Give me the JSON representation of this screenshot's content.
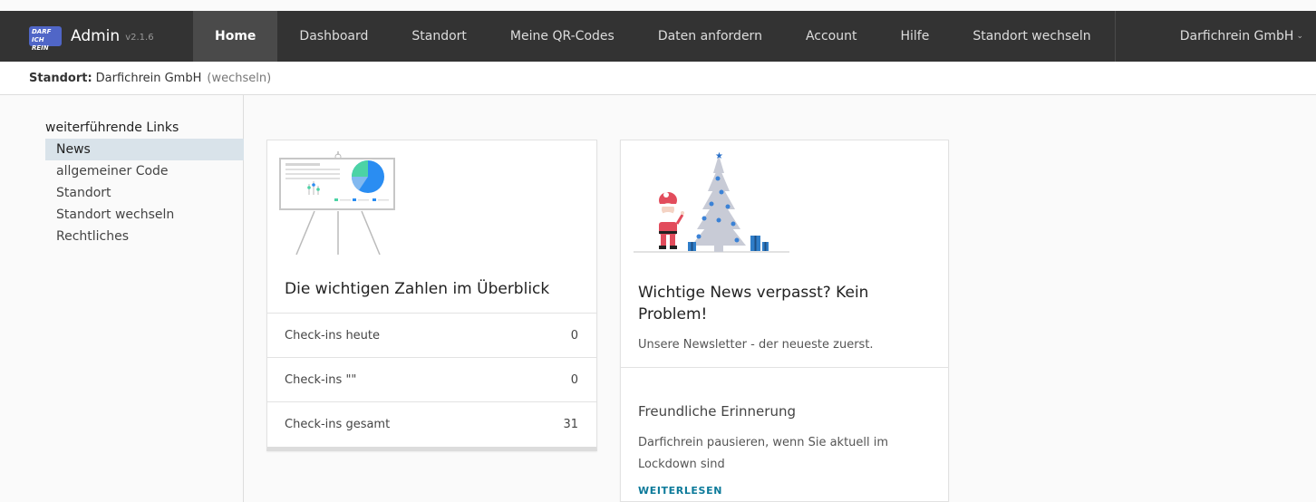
{
  "app": {
    "logo_text": "DARF ICH REIN",
    "name": "Admin",
    "version": "v2.1.6"
  },
  "nav": {
    "items": [
      {
        "label": "Home",
        "active": true
      },
      {
        "label": "Dashboard"
      },
      {
        "label": "Standort"
      },
      {
        "label": "Meine QR-Codes"
      },
      {
        "label": "Daten anfordern"
      },
      {
        "label": "Account"
      },
      {
        "label": "Hilfe"
      },
      {
        "label": "Standort wechseln"
      }
    ],
    "account_label": "Darfichrein GmbH"
  },
  "location_bar": {
    "label": "Standort:",
    "value": "Darfichrein GmbH",
    "change_link": "(wechseln)"
  },
  "sidebar": {
    "title": "weiterführende Links",
    "items": [
      {
        "label": "News",
        "active": true
      },
      {
        "label": "allgemeiner Code"
      },
      {
        "label": "Standort"
      },
      {
        "label": "Standort wechseln"
      },
      {
        "label": "Rechtliches"
      }
    ]
  },
  "stats_card": {
    "title": "Die wichtigen Zahlen im Überblick",
    "rows": [
      {
        "label": "Check-ins heute",
        "value": "0"
      },
      {
        "label": "Check-ins \"\"",
        "value": "0"
      },
      {
        "label": "Check-ins gesamt",
        "value": "31"
      }
    ]
  },
  "news_card": {
    "title": "Wichtige News verpasst? Kein Problem!",
    "subtitle": "Unsere Newsletter - der neueste zuerst.",
    "news_title": "Freundliche Erinnerung",
    "news_text": "Darfichrein pausieren, wenn Sie aktuell im Lockdown sind",
    "news_link": "WEITERLESEN"
  },
  "colors": {
    "topbar": "#333333",
    "active_nav": "#4a4a4a",
    "sidebar_active": "#d9e3ea",
    "link": "#0c7a9a",
    "logo": "#5066c7"
  }
}
